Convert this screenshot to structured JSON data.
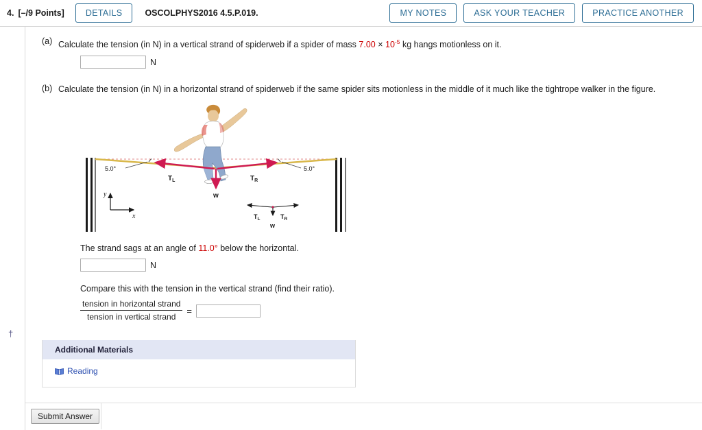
{
  "header": {
    "question_number": "4.",
    "points": "[–/9 Points]",
    "details_button": "DETAILS",
    "question_code": "OSCOLPHYS2016 4.5.P.019.",
    "my_notes_button": "MY NOTES",
    "ask_teacher_button": "ASK YOUR TEACHER",
    "practice_another_button": "PRACTICE ANOTHER",
    "accent_color": "#2b6c94"
  },
  "parts": {
    "a": {
      "label": "(a)",
      "text_before": "Calculate the tension (in N) in a vertical strand of spiderweb if a spider of mass ",
      "mass_value": "7.00",
      "mass_times": " × ",
      "mass_base": "10",
      "mass_exponent": "-5",
      "text_after": " kg hangs motionless on it.",
      "answer_value": "",
      "unit": "N"
    },
    "b": {
      "label": "(b)",
      "text": "Calculate the tension (in N) in a horizontal strand of spiderweb if the same spider sits motionless in the middle of it much like the tightrope walker in the figure.",
      "sag_text_before": "The strand sags at an angle of ",
      "sag_angle": "11.0°",
      "sag_text_after": " below the horizontal.",
      "answer_value": "",
      "unit": "N",
      "compare_text": "Compare this with the tension in the vertical strand (find their ratio).",
      "ratio_numerator": "tension in horizontal strand",
      "ratio_denominator": "tension in vertical strand",
      "ratio_equals": "=",
      "ratio_value": ""
    }
  },
  "figure": {
    "alt": "tightrope-walker-free-body-diagram",
    "angle_left": "5.0°",
    "angle_right": "5.0°",
    "tension_left": "T",
    "tension_left_sub": "L",
    "tension_right": "T",
    "tension_right_sub": "R",
    "weight": "w",
    "axis_y": "y",
    "axis_x": "x",
    "fbd_tension_left": "T",
    "fbd_tension_left_sub": "L",
    "fbd_tension_right": "T",
    "fbd_tension_right_sub": "R",
    "fbd_weight": "w",
    "rope_color": "#d9b84c",
    "vector_color": "#cf1a52",
    "shirt_color": "#ffffff",
    "pants_color": "#8fa8cc",
    "skin_color": "#e8c89a",
    "hair_color": "#c98b3a"
  },
  "footnote_symbol": "†",
  "additional_materials": {
    "title": "Additional Materials",
    "items": [
      {
        "label": "Reading",
        "icon": "book-icon"
      }
    ],
    "header_bg": "#e2e6f4",
    "link_color": "#2c4fb0"
  },
  "submit": {
    "label": "Submit Answer"
  }
}
